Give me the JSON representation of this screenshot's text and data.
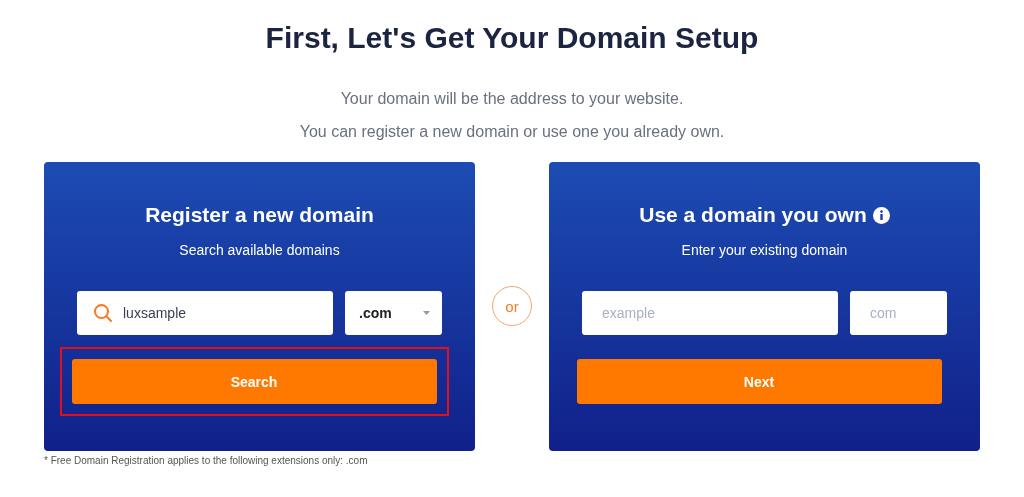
{
  "heading": "First, Let's Get Your Domain Setup",
  "intro": [
    "Your domain will be the address to your website.",
    "You can register a new domain or use one you already own."
  ],
  "register": {
    "title": "Register a new domain",
    "subtitle": "Search available domains",
    "search_value": "luxsample",
    "extension": ".com",
    "button": {
      "label": "Search",
      "highlighted": true
    }
  },
  "separator": "or",
  "existing": {
    "title": "Use a domain you own",
    "subtitle": "Enter your existing domain",
    "name_placeholder": "example",
    "extension_placeholder": "com",
    "button": {
      "label": "Next",
      "highlighted": false
    }
  },
  "footnote": "* Free Domain Registration applies to the following extensions only: .com"
}
